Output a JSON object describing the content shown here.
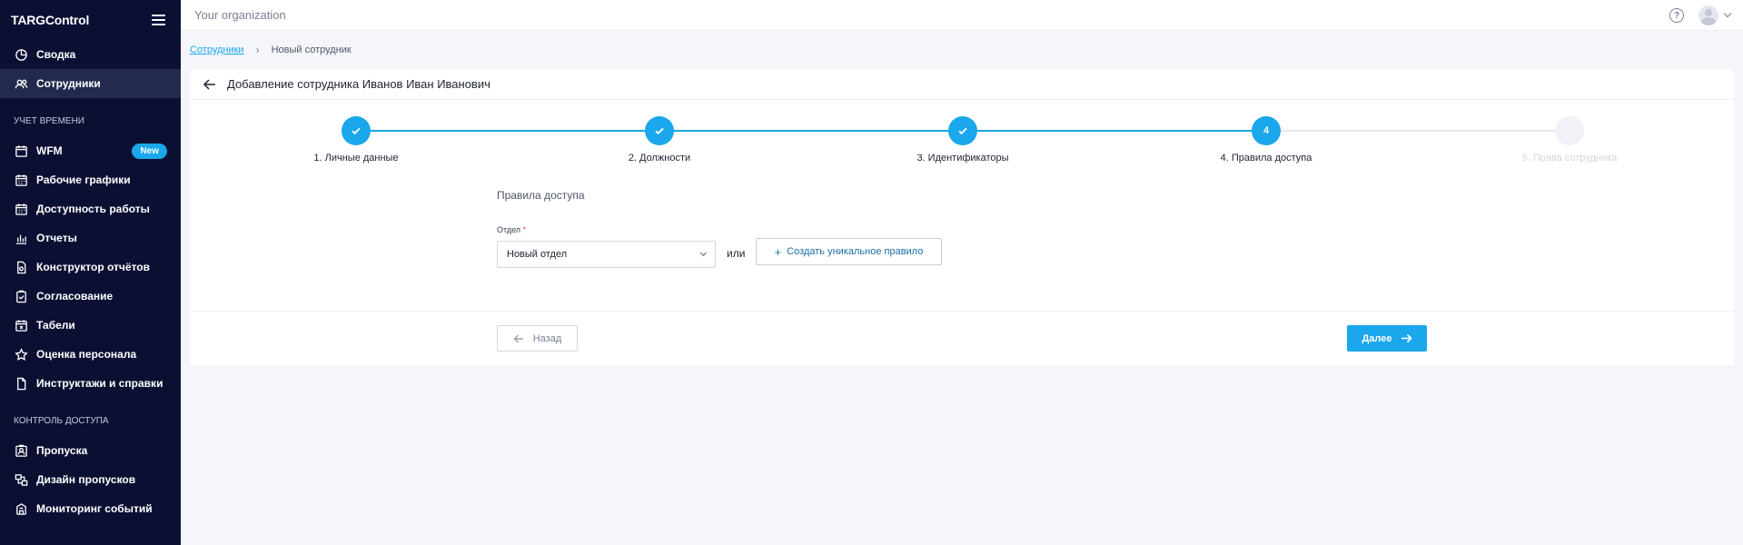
{
  "app": {
    "logo": "TARGControl",
    "organization": "Your organization"
  },
  "sidebar": {
    "items_top": [
      {
        "label": "Сводка",
        "icon": "chart-pie-icon"
      },
      {
        "label": "Сотрудники",
        "icon": "users-icon",
        "active": true
      }
    ],
    "section_time": "УЧЕТ ВРЕМЕНИ",
    "items_time": [
      {
        "label": "WFM",
        "icon": "calendar-icon",
        "badge": "New"
      },
      {
        "label": "Рабочие графики",
        "icon": "calendar-grid-icon"
      },
      {
        "label": "Доступность работы",
        "icon": "calendar-grid-icon"
      },
      {
        "label": "Отчеты",
        "icon": "bar-chart-icon"
      },
      {
        "label": "Конструктор отчётов",
        "icon": "file-settings-icon"
      },
      {
        "label": "Согласование",
        "icon": "clipboard-check-icon"
      },
      {
        "label": "Табели",
        "icon": "calendar-x-icon"
      },
      {
        "label": "Оценка персонала",
        "icon": "star-icon"
      },
      {
        "label": "Инструктажи и справки",
        "icon": "file-icon"
      }
    ],
    "section_access": "КОНТРОЛЬ ДОСТУПА",
    "items_access": [
      {
        "label": "Пропуска",
        "icon": "id-card-icon"
      },
      {
        "label": "Дизайн пропусков",
        "icon": "design-icon"
      },
      {
        "label": "Мониторинг событий",
        "icon": "monitor-icon"
      }
    ]
  },
  "breadcrumb": {
    "parent": "Сотрудники",
    "current": "Новый сотрудник"
  },
  "card": {
    "title": "Добавление сотрудника Иванов Иван Иванович"
  },
  "stepper": {
    "steps": [
      {
        "label": "1. Личные данные",
        "state": "done",
        "number": "1"
      },
      {
        "label": "2. Должности",
        "state": "done",
        "number": "2"
      },
      {
        "label": "3. Идентификаторы",
        "state": "done",
        "number": "3"
      },
      {
        "label": "4. Правила доступа",
        "state": "current",
        "number": "4"
      },
      {
        "label": "5. Права сотрудника",
        "state": "pending",
        "number": "5"
      }
    ]
  },
  "form": {
    "section_heading": "Правила доступа",
    "department_label": "Отдел",
    "required_mark": "*",
    "department_value": "Новый отдел",
    "or_text": "или",
    "create_rule_label": "Создать уникальное правило"
  },
  "footer": {
    "back_label": "Назад",
    "next_label": "Далее"
  },
  "colors": {
    "accent": "#1aa7ec",
    "sidebar_bg": "#0b1033",
    "sidebar_active": "#232a4e"
  }
}
